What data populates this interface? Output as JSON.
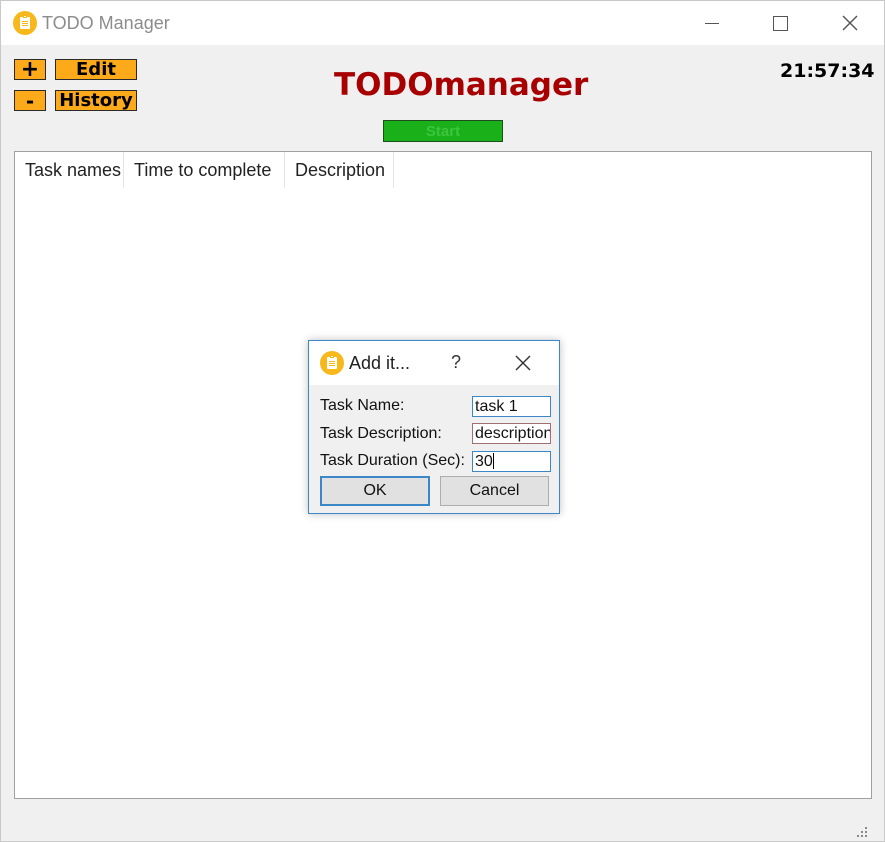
{
  "window": {
    "title": "TODO Manager",
    "icon": "clipboard-icon"
  },
  "toolbar": {
    "add_label": "+",
    "remove_label": "-",
    "edit_label": "Edit",
    "history_label": "History",
    "heading": "TODOmanager",
    "clock": "21:57:34",
    "start_label": "Start"
  },
  "table": {
    "columns": [
      "Task names",
      "Time to complete",
      "Description"
    ],
    "rows": []
  },
  "dialog": {
    "title": "Add it...",
    "help_label": "?",
    "fields": [
      {
        "label": "Task Name:",
        "value": "task 1"
      },
      {
        "label": "Task Description:",
        "value": "description"
      },
      {
        "label": "Task Duration (Sec):",
        "value": "30"
      }
    ],
    "ok_label": "OK",
    "cancel_label": "Cancel"
  },
  "colors": {
    "button_orange": "#fdaa1a",
    "heading_red": "#a80000",
    "start_green": "#1ab01a",
    "icon_yellow": "#f6b81a",
    "focus_blue": "#3c87c8"
  }
}
